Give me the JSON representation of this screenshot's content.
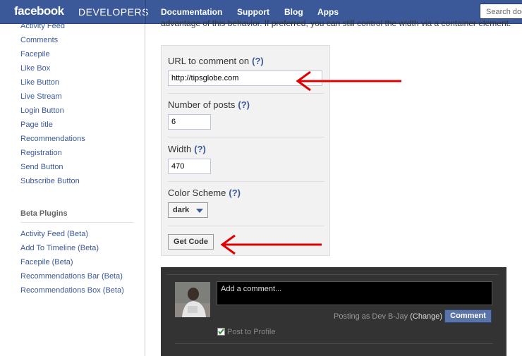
{
  "header": {
    "brand_bold": "facebook",
    "brand_light": "DEVELOPERS",
    "nav": [
      "Documentation",
      "Support",
      "Blog",
      "Apps"
    ],
    "search_placeholder": "Search doc"
  },
  "sidebar": {
    "plugins": [
      "Activity Feed",
      "Comments",
      "Facepile",
      "Like Box",
      "Like Button",
      "Live Stream",
      "Login Button",
      "Page title",
      "Recommendations",
      "Registration",
      "Send Button",
      "Subscribe Button"
    ],
    "beta_heading": "Beta Plugins",
    "beta": [
      "Activity Feed (Beta)",
      "Add To Timeline (Beta)",
      "Facepile (Beta)",
      "Recommendations Bar (Beta)",
      "Recommendations Box (Beta)"
    ]
  },
  "main": {
    "intro": "advantage of this behavior. If preferred, you can still control the width via a container element."
  },
  "form": {
    "help": "(?)",
    "url_label": "URL to comment on",
    "url_value": "http://tipsglobe.com",
    "posts_label": "Number of posts",
    "posts_value": "6",
    "width_label": "Width",
    "width_value": "470",
    "scheme_label": "Color Scheme",
    "scheme_value": "dark",
    "get_code": "Get Code"
  },
  "preview": {
    "placeholder": "Add a comment...",
    "posting_as": "Posting as Dev B-Jay",
    "change": "(Change)",
    "comment_button": "Comment",
    "post_to_profile": "Post to Profile"
  },
  "colors": {
    "brand": "#3b5998",
    "arrow": "#e00000",
    "dark_bg": "#333333"
  }
}
